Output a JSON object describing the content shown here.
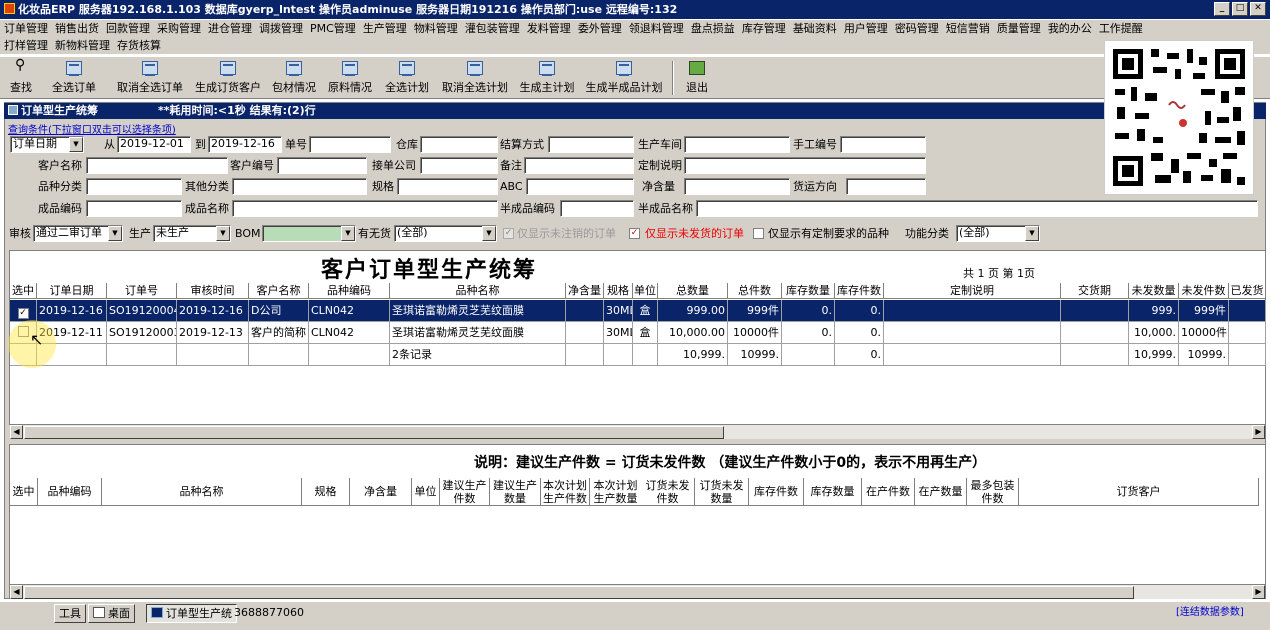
{
  "window": {
    "title": "化妆品ERP   服务器192.168.1.103  数据库gyerp_lntest  操作员adminuse  服务器日期191216  操作员部门:use 远程编号:132",
    "min": "_",
    "max": "□",
    "close": "✕"
  },
  "menu": {
    "row1": [
      "订单管理",
      "销售出货",
      "回款管理",
      "采购管理",
      "进仓管理",
      "调拨管理",
      "PMC管理",
      "生产管理",
      "物料管理",
      "灌包装管理",
      "发料管理",
      "委外管理",
      "领退料管理",
      "盘点损益",
      "库存管理",
      "基础资料",
      "用户管理",
      "密码管理",
      "短信营销",
      "质量管理",
      "我的办公",
      "工作提醒"
    ],
    "row2": [
      "打样管理",
      "新物料管理",
      "存货核算"
    ]
  },
  "toolbar": [
    "查找",
    "全选订单",
    "取消全选订单",
    "生成订货客户",
    "包材情况",
    "原料情况",
    "全选计划",
    "取消全选计划",
    "生成主计划",
    "生成半成品计划",
    "退出"
  ],
  "panel": {
    "title": "订单型生产统筹",
    "status": "**耗用时间:<1秒  结果有:(2)行",
    "hint": "查询条件(下拉窗口双击可以选择条项)"
  },
  "filters": {
    "date_type": "订单日期",
    "from_label": "从",
    "from": "2019-12-01",
    "to_label": "到",
    "to": "2019-12-16",
    "labels": {
      "order_no": "单号",
      "warehouse": "仓库",
      "settle": "结算方式",
      "workshop": "生产车间",
      "manual_no": "手工编号",
      "customer_name": "客户名称",
      "customer_code": "客户编号",
      "receiver_co": "接单公司",
      "remark": "备注",
      "custom_desc": "定制说明",
      "category": "品种分类",
      "other_cat": "其他分类",
      "spec": "规格",
      "abc": "ABC",
      "net": "净含量",
      "ship_dir": "货运方向",
      "fp_code": "成品编码",
      "fp_name": "成品名称",
      "semi_code": "半成品编码",
      "semi_name": "半成品名称"
    }
  },
  "filter2": {
    "audit_label": "审核",
    "audit": "通过二审订单",
    "prod_label": "生产",
    "prod": "未生产",
    "bom_label": "BOM",
    "stock_label": "有无货",
    "stock": "(全部)",
    "chk1": "仅显示未注销的订单",
    "chk2": "仅显示未发货的订单",
    "chk3": "仅显示有定制要求的品种",
    "func_label": "功能分类",
    "func": "(全部)"
  },
  "grid1": {
    "title": "客户订单型生产统筹",
    "pageinfo": "共 1 页 第 1页",
    "headers": [
      "选中",
      "订单日期",
      "订单号",
      "审核时间",
      "客户名称",
      "品种编码",
      "品种名称",
      "净含量",
      "规格",
      "单位",
      "总数量",
      "总件数",
      "库存数量",
      "库存件数",
      "定制说明",
      "交货期",
      "未发数量",
      "未发件数",
      "已发货"
    ],
    "rows": [
      [
        "✓",
        "2019-12-16",
        "SO19120004",
        "2019-12-16",
        "D公司",
        "CLN042",
        "圣琪诺富勒烯灵芝芜纹面膜",
        "",
        "30ML",
        "盒",
        "999.00",
        "999件",
        "0.",
        "0.",
        "",
        "",
        "999.",
        "999件",
        ""
      ],
      [
        "",
        "2019-12-11",
        "SO19120003",
        "2019-12-13",
        "客户的简称",
        "CLN042",
        "圣琪诺富勒烯灵芝芜纹面膜",
        "",
        "30ML",
        "盒",
        "10,000.00",
        "10000件",
        "0.",
        "0.",
        "",
        "",
        "10,000.",
        "10000件",
        ""
      ],
      [
        "",
        "",
        "",
        "",
        "",
        "",
        "2条记录",
        "",
        "",
        "",
        "10,999.",
        "10999.",
        "",
        "0.",
        "",
        "",
        "10,999.",
        "10999.",
        ""
      ]
    ]
  },
  "grid2": {
    "note": "说明：建议生产件数 = 订货未发件数  （建议生产件数小于0的，表示不用再生产）",
    "headers": [
      "选中",
      "品种编码",
      "品种名称",
      "规格",
      "净含量",
      "单位",
      "建议生产件数",
      "建议生产数量",
      "本次计划生产件数",
      "本次计划生产数量",
      "订货未发件数",
      "订货未发数量",
      "库存件数",
      "库存数量",
      "在产件数",
      "在产数量",
      "最多包装件数",
      "订货客户"
    ]
  },
  "statusbar": {
    "tools": "工具",
    "desktop": "桌面",
    "task": "订单型生产统",
    "phone": "3688877060",
    "link": "[连结数据参数]"
  }
}
